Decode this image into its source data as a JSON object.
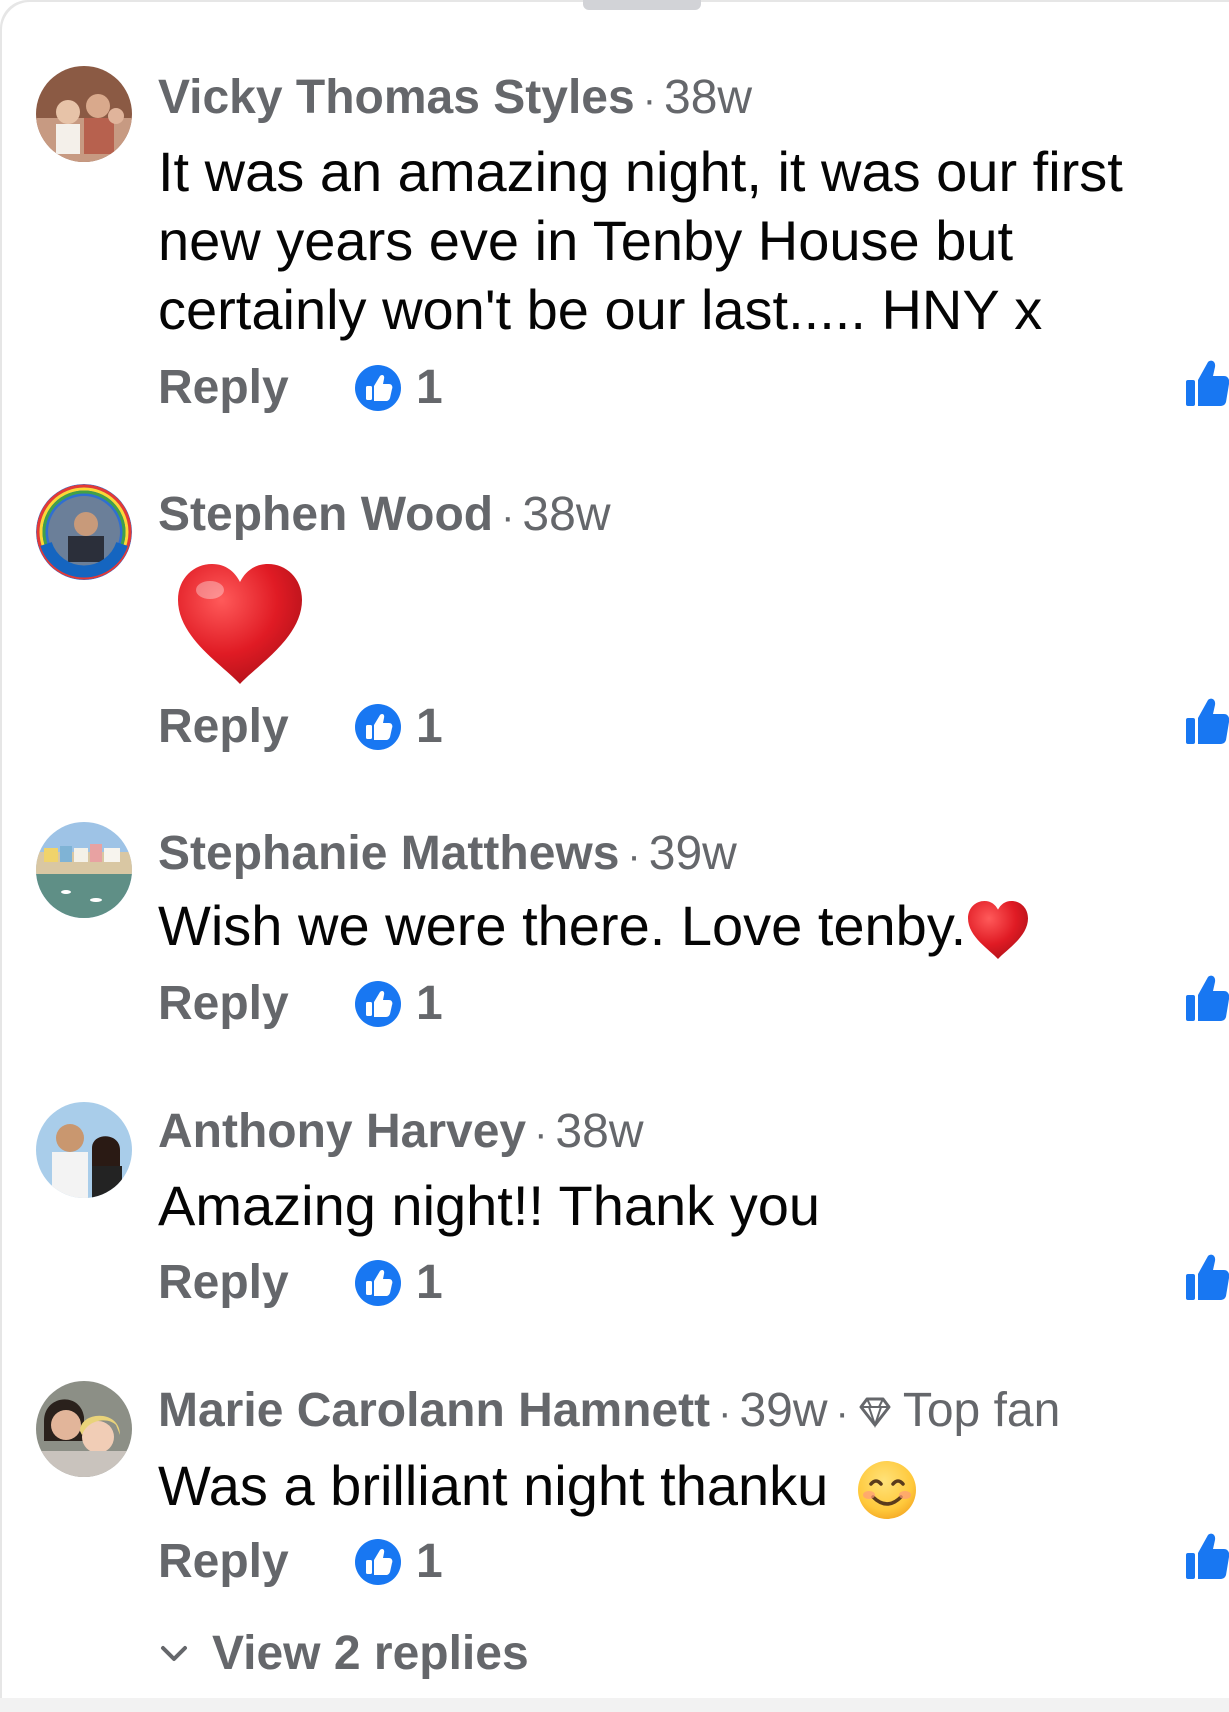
{
  "comments": [
    {
      "author": "Vicky Thomas Styles",
      "time": "38w",
      "text_lines": [
        "It was an amazing night,  it was our first",
        "new years eve in Tenby House  but",
        "certainly won't be our last..... HNY x"
      ],
      "reply_label": "Reply",
      "like_count": "1"
    },
    {
      "author": "Stephen Wood",
      "time": "38w",
      "body_emoji": "red-heart",
      "reply_label": "Reply",
      "like_count": "1"
    },
    {
      "author": "Stephanie Matthews",
      "time": "39w",
      "text": "Wish we were there. Love tenby.",
      "text_emoji": "red-heart",
      "reply_label": "Reply",
      "like_count": "1"
    },
    {
      "author": "Anthony Harvey",
      "time": "38w",
      "text": "Amazing night!! Thank you",
      "reply_label": "Reply",
      "like_count": "1"
    },
    {
      "author": "Marie Carolann Hamnett",
      "time": "39w",
      "badge": "Top fan",
      "badge_icon": "diamond-icon",
      "text": "Was a brilliant night thanku",
      "text_emoji": "smiling-face",
      "reply_label": "Reply",
      "like_count": "1"
    }
  ],
  "view_replies_label": "View 2 replies",
  "colors": {
    "meta_gray": "#65676b",
    "text": "#050505",
    "like_blue": "#1877f2",
    "heart_red": "#e0245e"
  },
  "icons": {
    "reaction": "thumbs-up-icon",
    "side_action": "like-icon",
    "expand": "chevron-down-icon"
  }
}
